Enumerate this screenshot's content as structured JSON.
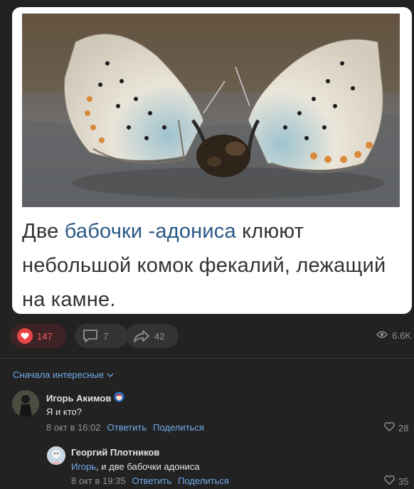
{
  "post": {
    "caption_before": "Две ",
    "caption_link": "бабочки -адониса",
    "caption_after": " клюют небольшой комок фекалий, лежащий на камне."
  },
  "actions": {
    "likes": "147",
    "comments": "7",
    "shares": "42",
    "views": "6.6K",
    "like_color": "#ff5c5c"
  },
  "comments_section": {
    "sort_label": "Сначала интересные",
    "items": [
      {
        "author": "Игорь Акимов",
        "text": "Я и кто?",
        "time": "8 окт в 16:02",
        "reply": "Ответить",
        "share": "Поделиться",
        "likes": "28"
      },
      {
        "author": "Георгий Плотников",
        "mention": "Игорь",
        "text": ", и две бабочки адониса",
        "time": "8 окт в 19:35",
        "reply": "Ответить",
        "share": "Поделиться",
        "likes": "35"
      }
    ]
  },
  "colors": {
    "background": "#222222",
    "accent": "#71aaeb",
    "link": "#2a5885"
  },
  "icons": [
    "heart-icon",
    "comment-icon",
    "share-icon",
    "eye-icon",
    "chevron-down-icon",
    "badge-icon"
  ]
}
